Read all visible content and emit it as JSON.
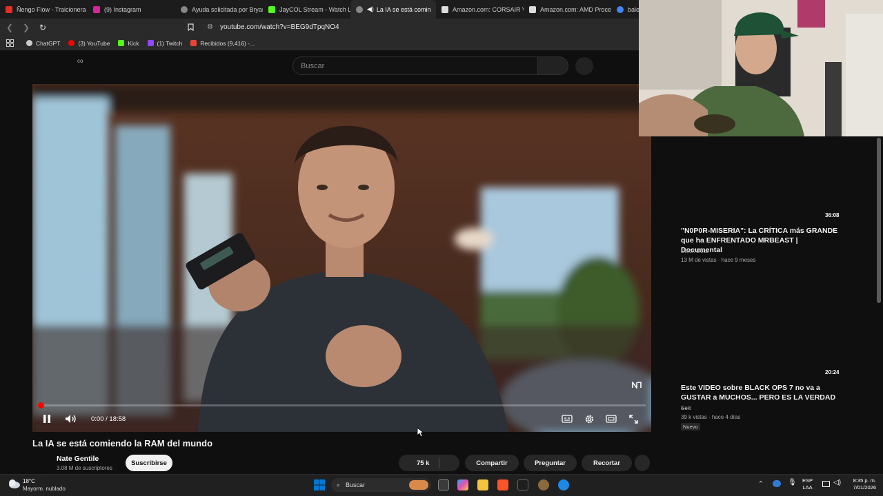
{
  "browser": {
    "tabs": [
      {
        "label": "Ñengo Flow - Traicionera",
        "color": "#e52d27"
      },
      {
        "label": "(9) Instagram",
        "color": "#d6249f"
      },
      {
        "label": "Ayuda solicitada por Bryan",
        "color": "#888888"
      },
      {
        "label": "JayCOL Stream - Watch Li",
        "color": "#53fc18"
      },
      {
        "label": "La IA se está comin",
        "color": "#888888",
        "active": true
      },
      {
        "label": "Amazon.com: CORSAIR Ve",
        "color": "#dddddd"
      },
      {
        "label": "Amazon.com: AMD Proce",
        "color": "#dddddd"
      },
      {
        "label": "bale",
        "color": "#4285f4"
      }
    ],
    "url": "youtube.com/watch?v=BEG9dTpqNO4",
    "bookmarks": [
      {
        "label": "ChatGPT",
        "color": "#cccccc"
      },
      {
        "label": "(3) YouTube",
        "color": "#ff0000"
      },
      {
        "label": "Kick",
        "color": "#53fc18"
      },
      {
        "label": "(1) Twitch",
        "color": "#9146ff"
      },
      {
        "label": "Recibidos (9,416) -...",
        "color": "#ea4335"
      }
    ]
  },
  "youtube": {
    "corner_text": "co",
    "search_placeholder": "Buscar",
    "video": {
      "time": "0:00 / 18:58",
      "progress": 0.01
    },
    "title": "La IA se está comiendo la RAM del mundo",
    "channel": {
      "name": "Nate Gentile",
      "subscribers": "3.08 M de suscriptores",
      "subscribe_label": "Suscribirse"
    },
    "actions": {
      "likes": "75 k",
      "share": "Compartir",
      "ask": "Preguntar",
      "clip": "Recortar"
    },
    "recommendations": [
      {
        "duration": "36:08",
        "title": "\"N0P0R-MISERIA\": La CRÍTICA más GRANDE que ha ENFRENTADO MRBEAST | Documental",
        "channel": "Dieck Docs",
        "meta": "13 M de vistas · hace 9 meses"
      },
      {
        "duration": "20:24",
        "title": "Este VIDEO sobre BLACK OPS 7 no va a GUSTAR a MUCHOS... PERO ES LA VERDAD ...",
        "channel": "Soki",
        "meta": "39 k vistas · hace 4 días",
        "badge": "Nuevo"
      }
    ]
  },
  "taskbar": {
    "weather_temp": "18°C",
    "weather_desc": "Mayorm. nublado",
    "search_label": "Buscar",
    "lang_top": "ESP",
    "lang_bottom": "LAA",
    "time": "8:35 p. m.",
    "date": "7/01/2026"
  },
  "colors": {
    "background": "#0f0f0f",
    "progress": "#ff0000",
    "windows_blue": "#0078d4"
  }
}
